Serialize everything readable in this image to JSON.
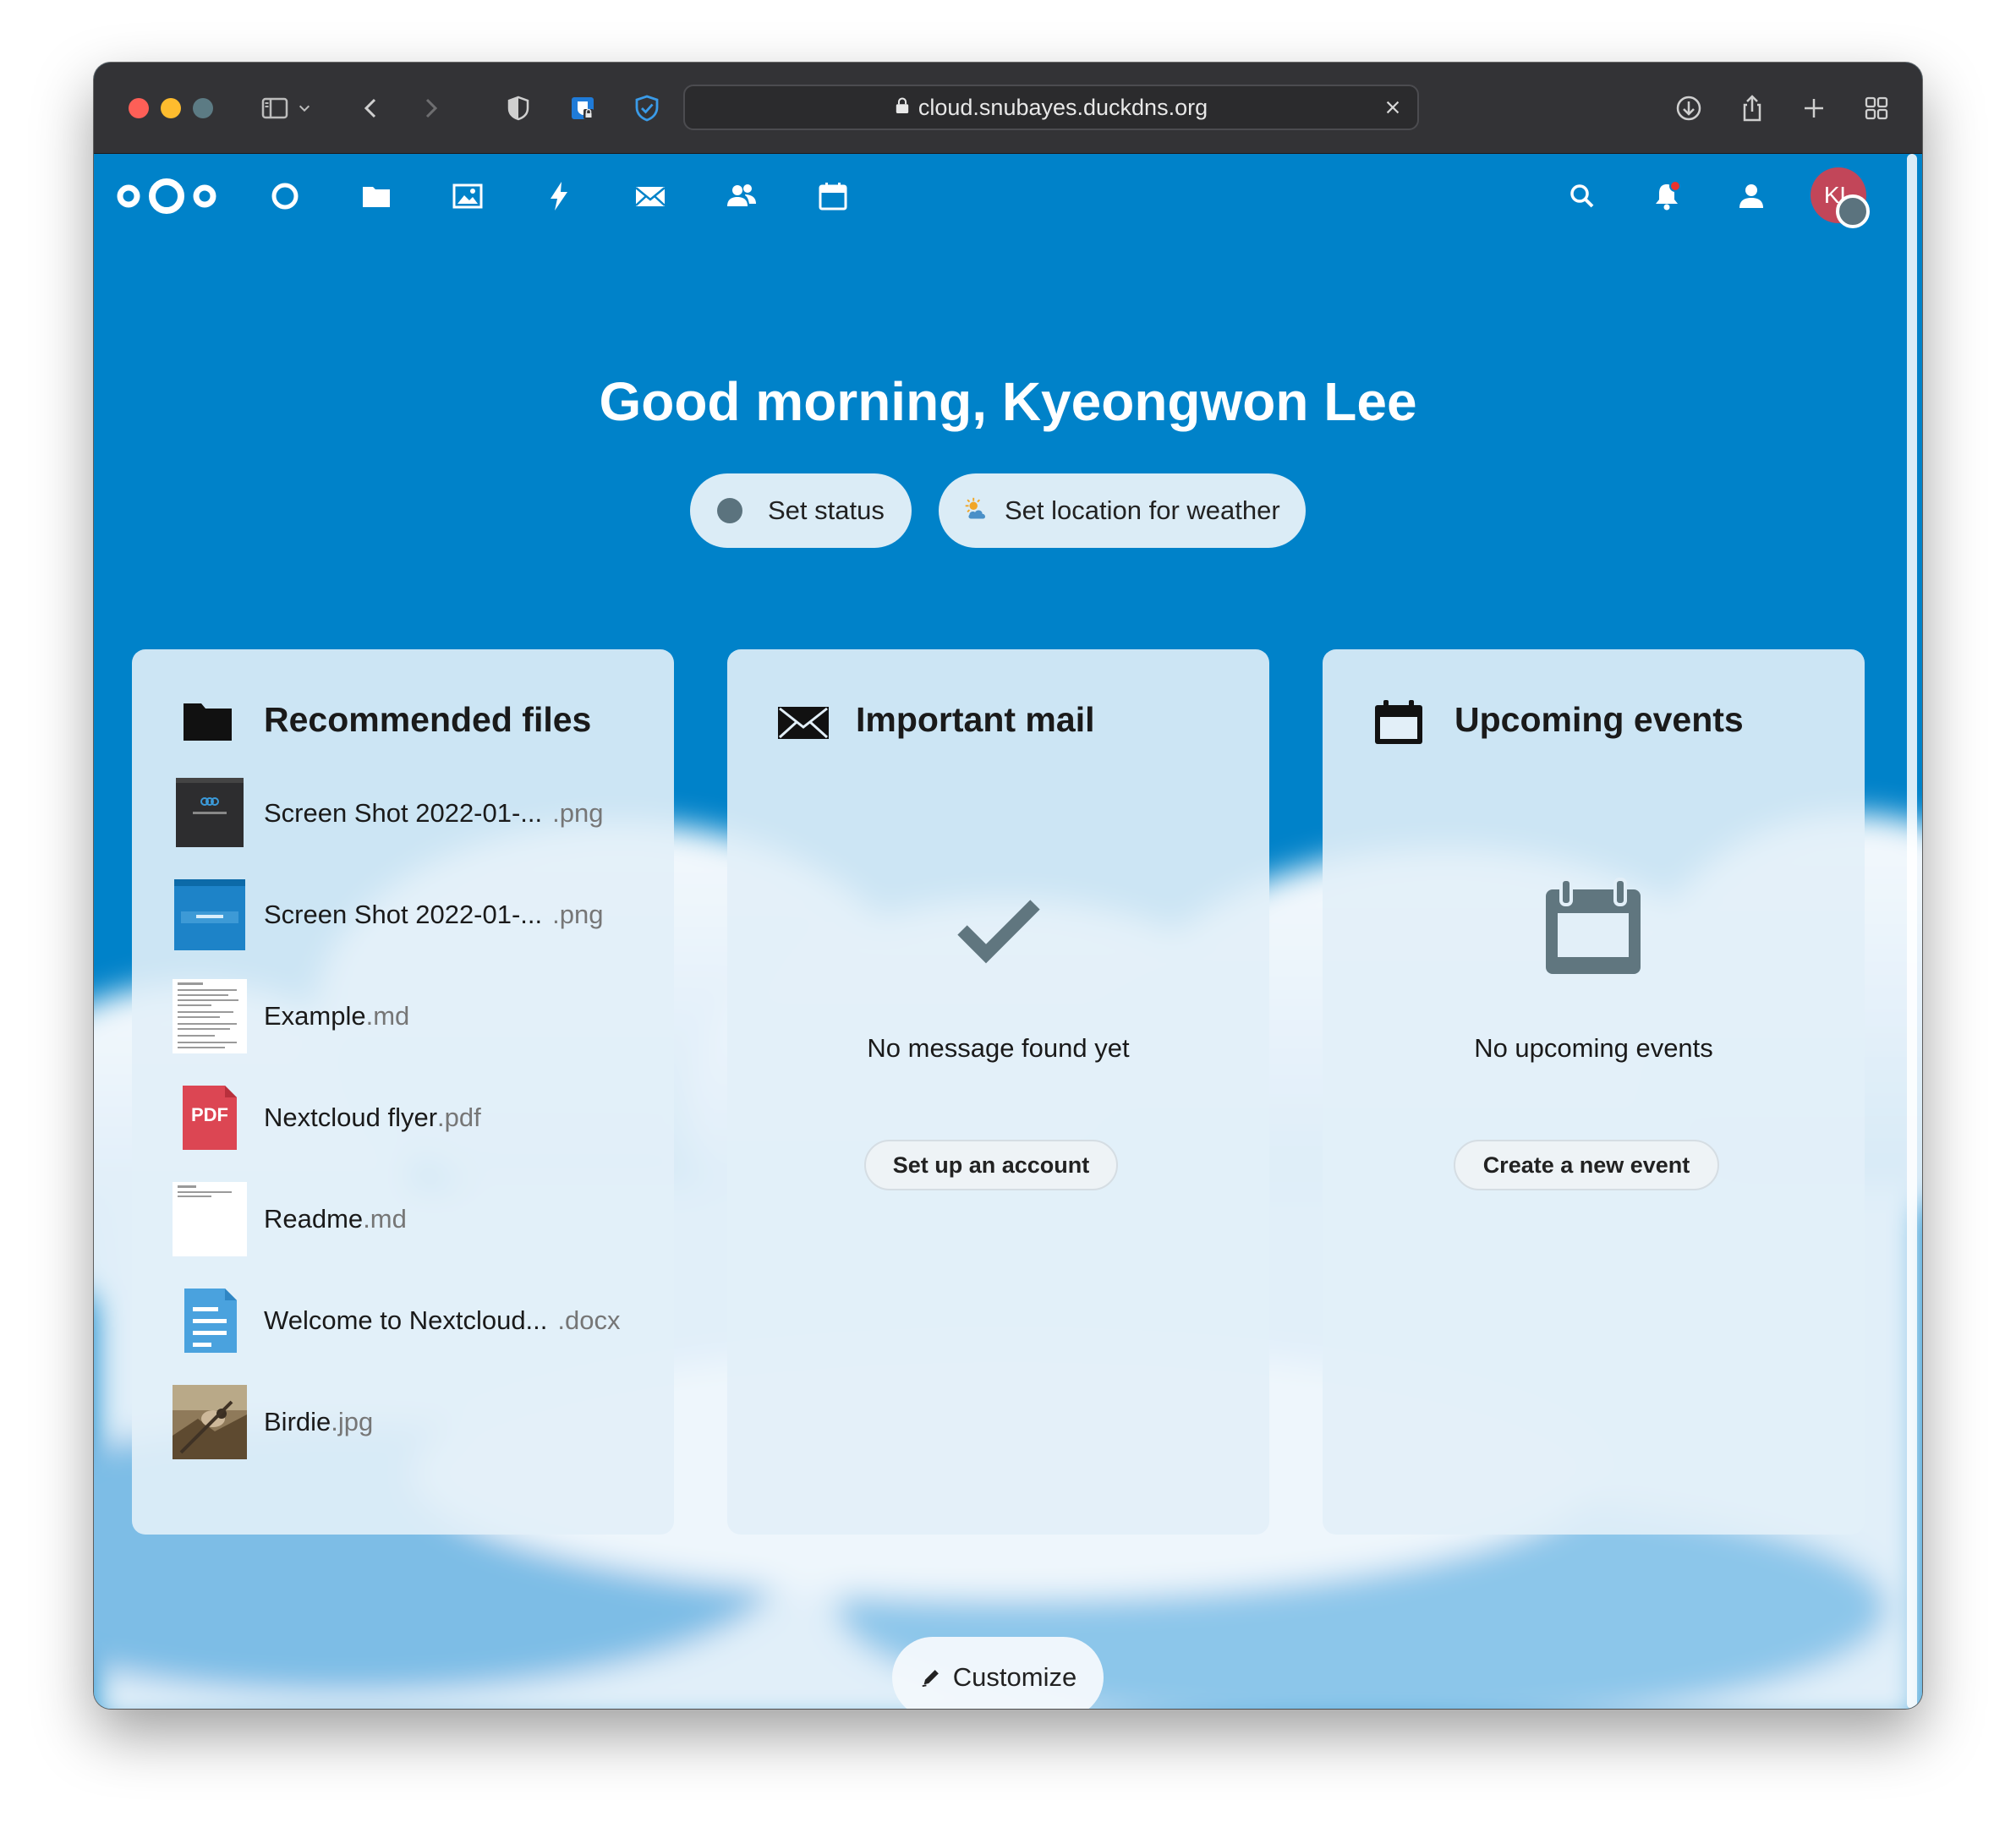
{
  "browser": {
    "url": "cloud.snubayes.duckdns.org"
  },
  "nav": {
    "apps": [
      {
        "name": "Dashboard",
        "icon": "dashboard-icon"
      },
      {
        "name": "Files",
        "icon": "folder-icon"
      },
      {
        "name": "Photos",
        "icon": "image-icon"
      },
      {
        "name": "Activity",
        "icon": "lightning-icon"
      },
      {
        "name": "Mail",
        "icon": "mail-icon"
      },
      {
        "name": "Contacts",
        "icon": "contacts-icon"
      },
      {
        "name": "Calendar",
        "icon": "calendar-icon"
      }
    ],
    "avatar_initials": "KL"
  },
  "greeting": "Good morning, Kyeongwon Lee",
  "status_button": "Set status",
  "weather_button": "Set location for weather",
  "widgets": {
    "files": {
      "title": "Recommended files",
      "items": [
        {
          "name": "Screen Shot 2022-01-...",
          "ext": ".png",
          "thumb": "dark-screenshot"
        },
        {
          "name": "Screen Shot 2022-01-...",
          "ext": ".png",
          "thumb": "blue-screenshot"
        },
        {
          "name": "Example",
          "ext": ".md",
          "thumb": "text-document"
        },
        {
          "name": "Nextcloud flyer",
          "ext": ".pdf",
          "thumb": "pdf-icon"
        },
        {
          "name": "Readme",
          "ext": ".md",
          "thumb": "text-document"
        },
        {
          "name": "Welcome to Nextcloud...",
          "ext": ".docx",
          "thumb": "docx-icon"
        },
        {
          "name": "Birdie",
          "ext": ".jpg",
          "thumb": "photo"
        }
      ],
      "pdf_badge": "PDF"
    },
    "mail": {
      "title": "Important mail",
      "empty_text": "No message found yet",
      "button": "Set up an account"
    },
    "events": {
      "title": "Upcoming events",
      "empty_text": "No upcoming events",
      "button": "Create a new event"
    }
  },
  "customize_button": "Customize",
  "colors": {
    "brand_blue": "#0082c9",
    "notification_dot": "#e9322d",
    "avatar": "#c24659"
  }
}
